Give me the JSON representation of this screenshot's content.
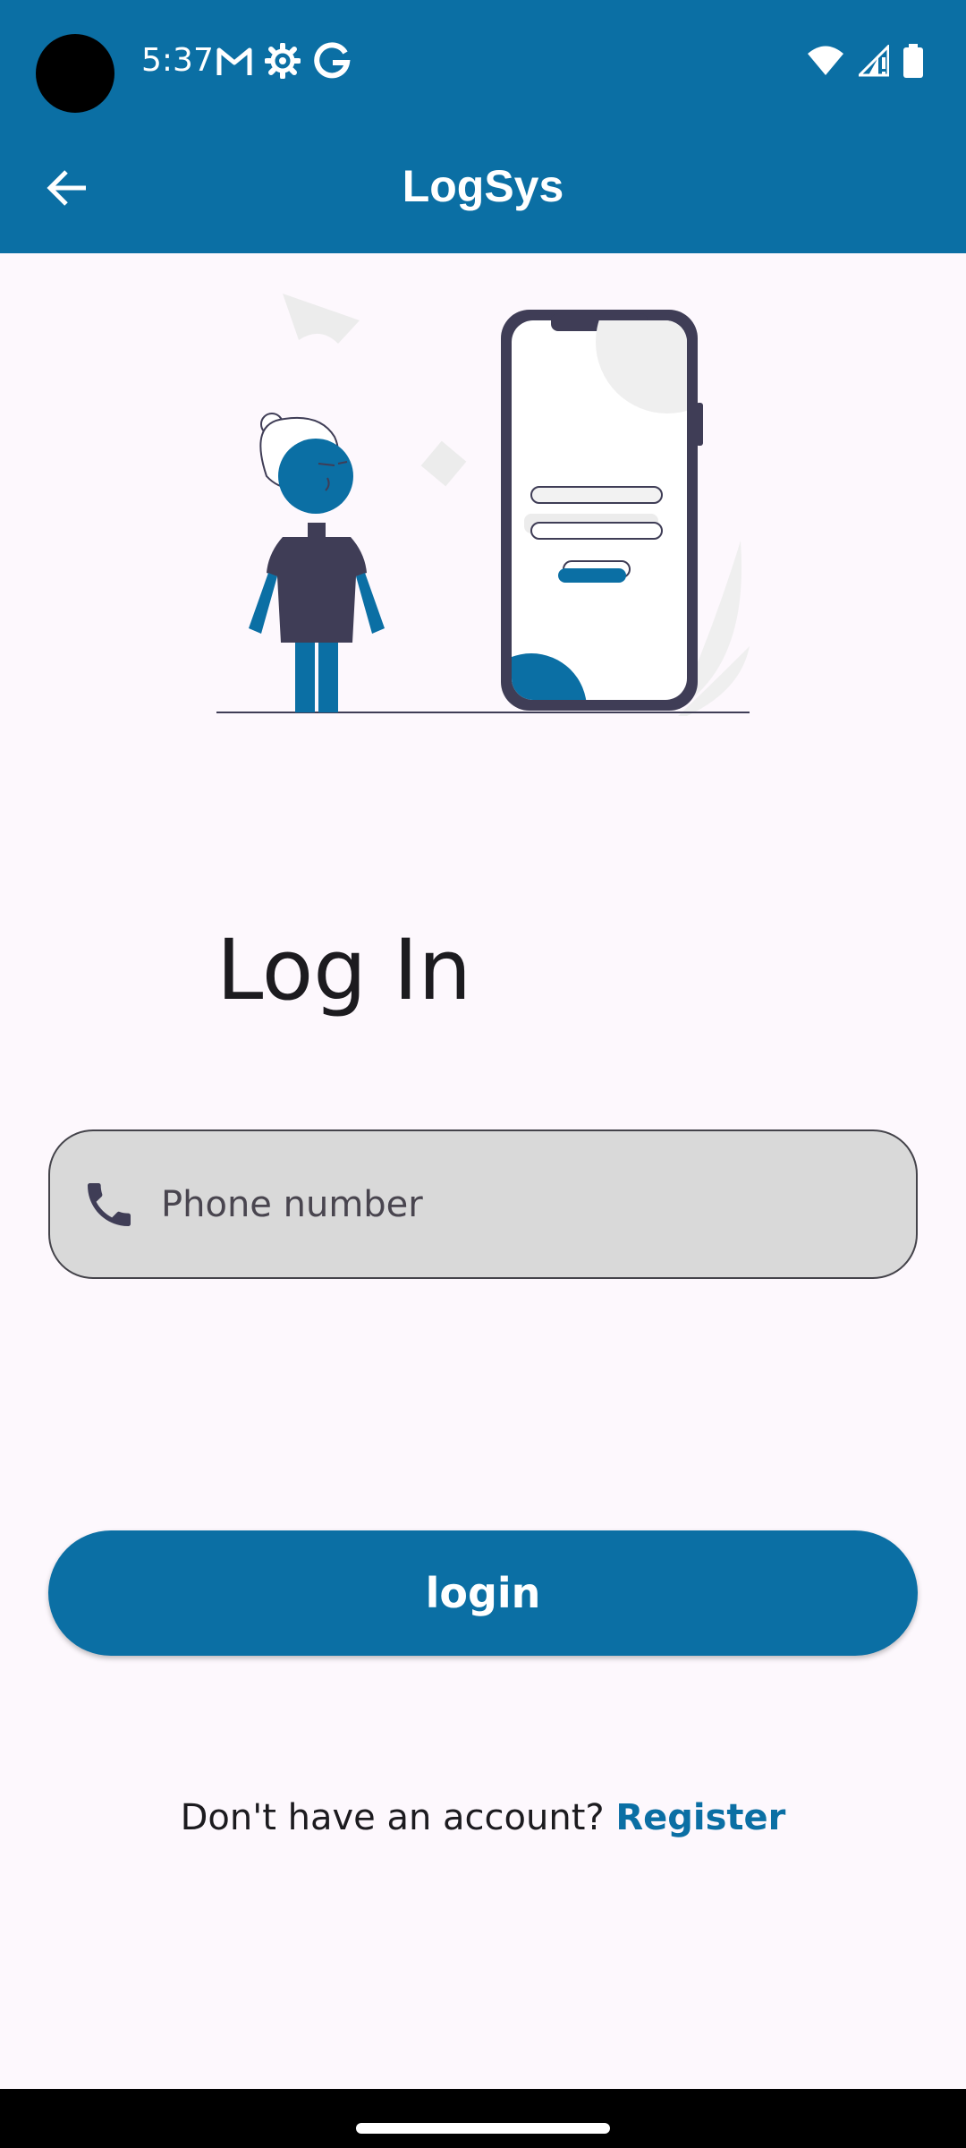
{
  "status_bar": {
    "time": "5:37",
    "icons_left": [
      "gmail-icon",
      "settings-icon",
      "google-icon"
    ],
    "icons_right": [
      "wifi-icon",
      "signal-icon",
      "battery-icon"
    ]
  },
  "app_bar": {
    "title": "LogSys",
    "back_icon": "arrow-back-icon"
  },
  "page": {
    "heading": "Log In"
  },
  "phone_field": {
    "placeholder": "Phone number",
    "value": "",
    "icon": "phone-icon"
  },
  "login_button": {
    "label": "login"
  },
  "register": {
    "prompt": "Don't have an account? ",
    "link_label": "Register"
  },
  "colors": {
    "primary": "#0b6fa4",
    "background": "#fdf8fd",
    "input_fill": "#d9d9d9",
    "illustration_dark": "#3f3d56"
  }
}
